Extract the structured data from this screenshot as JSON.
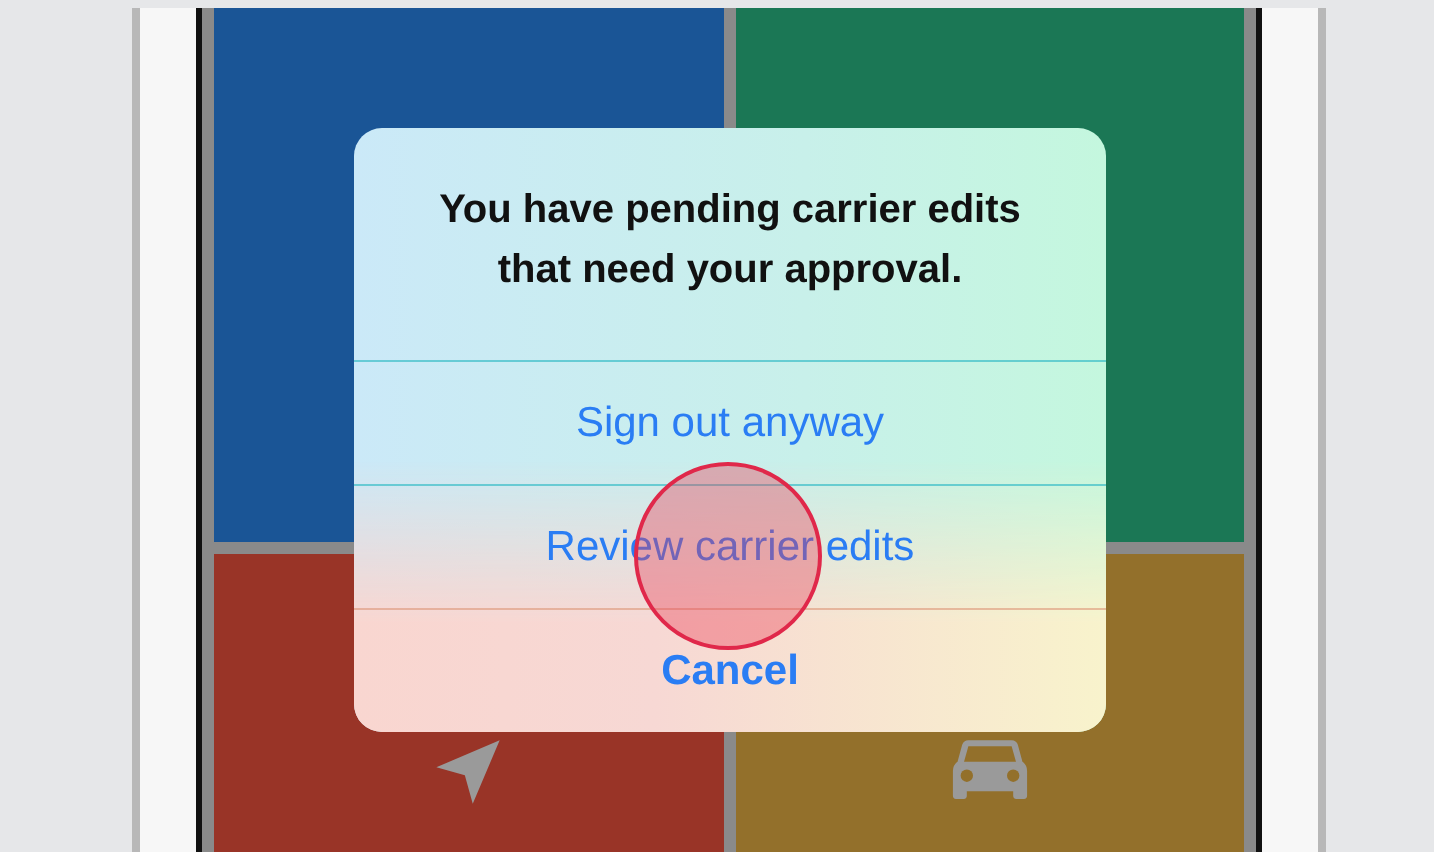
{
  "tiles": [
    {
      "color": "#1a5596",
      "kind": "blank"
    },
    {
      "color": "#1b7755",
      "kind": "blank"
    },
    {
      "color": "#993427",
      "kind": "location"
    },
    {
      "color": "#93702b",
      "kind": "car"
    }
  ],
  "alert": {
    "message": "You have pending carrier edits that need your approval.",
    "actions": [
      {
        "label": "Sign out anyway",
        "kind": "default"
      },
      {
        "label": "Review carrier edits",
        "kind": "default"
      },
      {
        "label": "Cancel",
        "kind": "cancel"
      }
    ]
  }
}
